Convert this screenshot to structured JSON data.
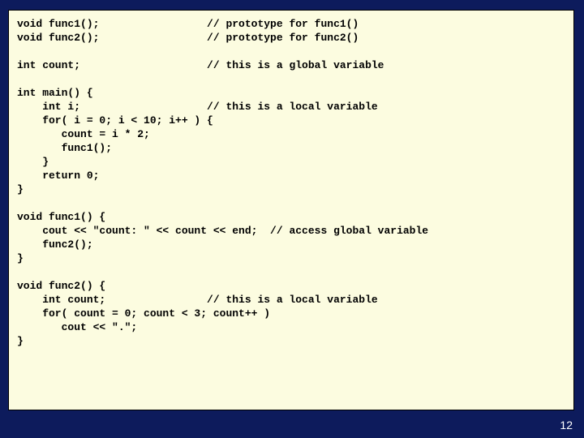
{
  "page_number": "12",
  "code": {
    "l01": "void func1();                 // prototype for func1()",
    "l02": "void func2();                 // prototype for func2()",
    "l03": "",
    "l04": "int count;                    // this is a global variable",
    "l05": "",
    "l06": "int main() {",
    "l07": "    int i;                    // this is a local variable",
    "l08": "    for( i = 0; i < 10; i++ ) {",
    "l09": "       count = i * 2;",
    "l10": "       func1();",
    "l11": "    }",
    "l12": "    return 0;",
    "l13": "}",
    "l14": "",
    "l15": "void func1() {",
    "l16": "    cout << \"count: \" << count << end;  // access global variable",
    "l17": "    func2();",
    "l18": "}",
    "l19": "",
    "l20": "void func2() {",
    "l21": "    int count;                // this is a local variable",
    "l22": "    for( count = 0; count < 3; count++ )",
    "l23": "       cout << \".\";",
    "l24": "}"
  }
}
